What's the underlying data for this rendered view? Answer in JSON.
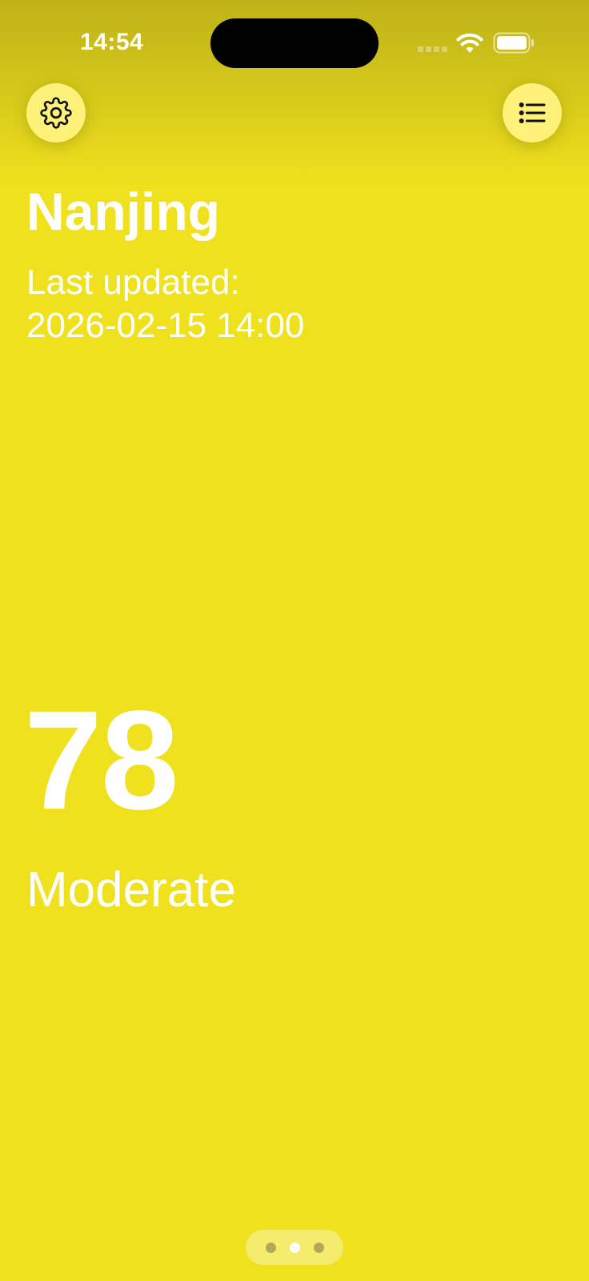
{
  "status_bar": {
    "time": "14:54"
  },
  "toolbar": {
    "settings_icon": "gear-icon",
    "list_icon": "list-icon"
  },
  "location": {
    "city": "Nanjing",
    "updated_label": "Last updated:",
    "updated_time": "2026-02-15 14:00"
  },
  "air_quality": {
    "aqi": "78",
    "level": "Moderate",
    "background_color": "#F0E11E"
  },
  "pager": {
    "page_count": 3,
    "current_page": 2
  }
}
